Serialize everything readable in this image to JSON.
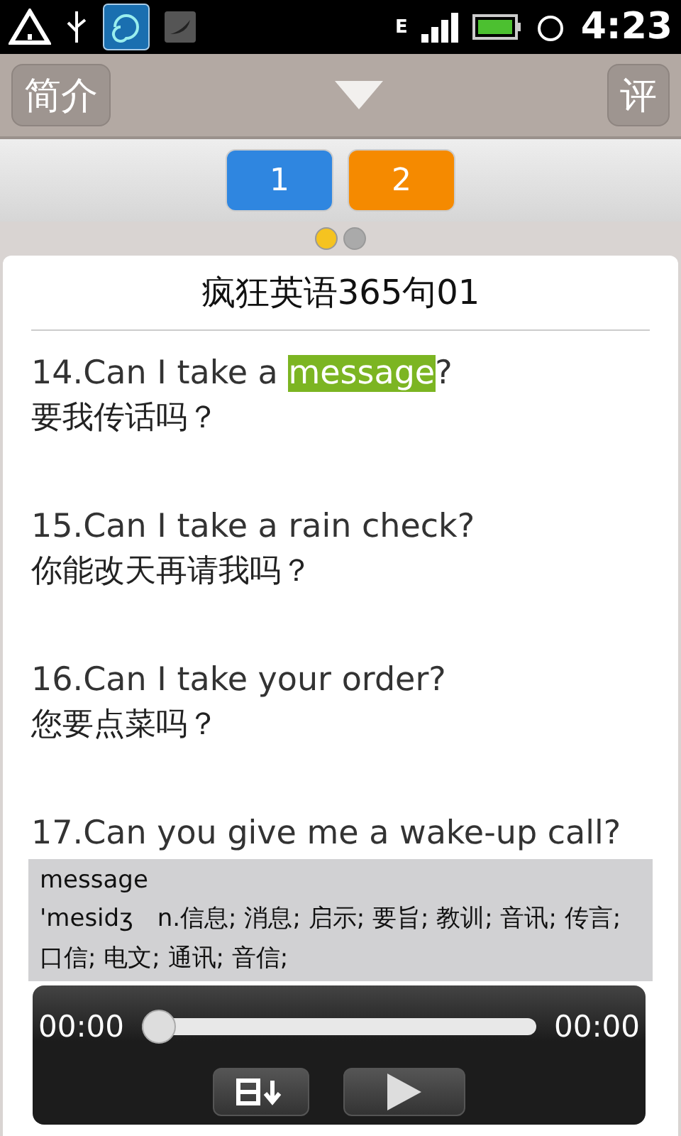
{
  "status_bar": {
    "network": "E",
    "time": "4:23"
  },
  "header": {
    "left_button": "简介",
    "right_button": "评"
  },
  "page_buttons": [
    {
      "label": "1",
      "color": "#2f86e0"
    },
    {
      "label": "2",
      "color": "#f58a00"
    }
  ],
  "page_dots": [
    {
      "selected": true
    },
    {
      "selected": false
    }
  ],
  "title": "疯狂英语365句01",
  "sentences": [
    {
      "parts": [
        {
          "text": "14.Can I take a ",
          "highlighted": false
        },
        {
          "text": "message",
          "highlighted": true
        },
        {
          "text": "?",
          "highlighted": false
        }
      ],
      "translation": "要我传话吗？"
    },
    {
      "parts": [
        {
          "text": "15.Can I take a rain check?",
          "highlighted": false
        }
      ],
      "translation": "你能改天再请我吗？"
    },
    {
      "parts": [
        {
          "text": "16.Can I take your order?",
          "highlighted": false
        }
      ],
      "translation": "您要点菜吗？"
    },
    {
      "parts": [
        {
          "text": "17.Can you give me a wake-up call?",
          "highlighted": false
        }
      ]
    }
  ],
  "dictionary": {
    "word": "message",
    "definition": "'mesidʒ　n.信息; 消息; 启示; 要旨; 教训; 音讯; 传言; 口信; 电文; 通讯; 音信;"
  },
  "player": {
    "elapsed": "00:00",
    "total": "00:00",
    "level": 0
  }
}
